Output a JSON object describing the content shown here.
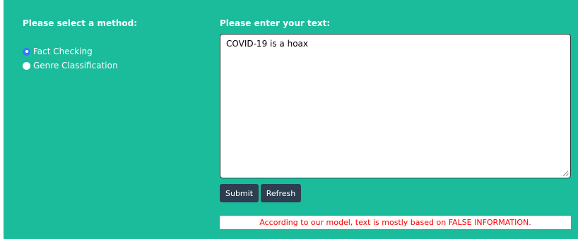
{
  "method": {
    "label": "Please select a method:",
    "options": [
      {
        "label": "Fact Checking",
        "checked": true
      },
      {
        "label": "Genre Classification",
        "checked": false
      }
    ]
  },
  "text_input": {
    "label": "Please enter your text:",
    "value": "COVID-19 is a hoax"
  },
  "buttons": {
    "submit": "Submit",
    "refresh": "Refresh"
  },
  "result": {
    "message": "According to our model, text is mostly based on FALSE INFORMATION."
  },
  "colors": {
    "background": "#1bbc9b",
    "button": "#2c3e50",
    "radio_selected": "#2f7df6",
    "result_text": "#ff0000"
  }
}
